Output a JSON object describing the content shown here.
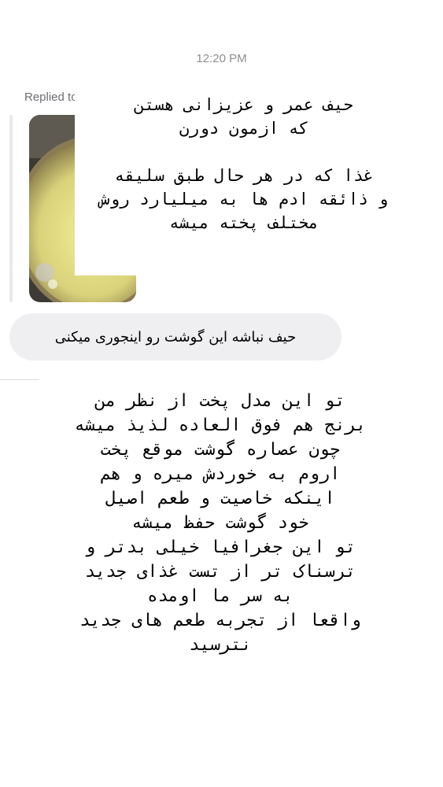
{
  "thread": {
    "timestamp": "12:20 PM",
    "replied_label": "Replied to you"
  },
  "reply_preview": {
    "image_icon": "food-photo-thumbnail",
    "overlay_text": "حیف عمر و عزیزانی هستن\nکه ازمون دورن\n\nغذا که در هر حال طبق سلیقه\nو ذائقه ادم ها به میلیارد روش\nمختلف پخته میشه"
  },
  "message": {
    "text": "حیف نباشه این گوشت رو اینجوری میکنی"
  },
  "caption": {
    "text": "تو این مدل پخت از نظر من\nبرنج هم فوق العاده لذیذ میشه\nچون عصاره گوشت موقع پخت\nاروم به خوردش میره و هم\nاینکه خاصیت و طعم اصیل\nخود گوشت حفظ میشه\nتو این جغرافیا خیلی بدتر و\nترسناک تر از تست غذای جدید\nبه سر ما اومده\nواقعا از تجربه طعم های جدید\nنترسید"
  }
}
